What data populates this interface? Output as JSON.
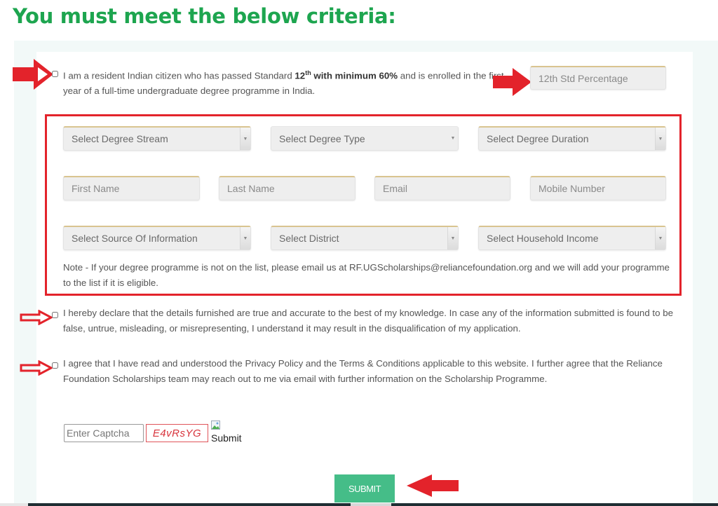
{
  "page": {
    "heading": "You must meet the below criteria:"
  },
  "eligibility": {
    "text_before": "I am a resident Indian citizen who has passed Standard ",
    "bold_12": "12",
    "sup_th": "th",
    "bold_min": " with minimum 60%",
    "text_after": " and is enrolled in the first year of a full-time undergraduate degree programme in India.",
    "checked": false,
    "percentage_placeholder": "12th Std Percentage"
  },
  "form": {
    "selects": {
      "degree_stream": "Select Degree Stream",
      "degree_type": "Select Degree Type",
      "degree_duration": "Select Degree Duration",
      "source_of_information": "Select Source Of Information",
      "district": "Select District",
      "household_income": "Select Household Income"
    },
    "inputs": {
      "first_name_placeholder": "First Name",
      "last_name_placeholder": "Last Name",
      "email_placeholder": "Email",
      "mobile_placeholder": "Mobile Number"
    },
    "note": "Note - If your degree programme is not on the list, please email us at RF.UGScholarships@reliancefoundation.org and we will add your programme to the list if it is eligible."
  },
  "declarations": [
    {
      "text": "I hereby declare that the details furnished are true and accurate to the best of my knowledge. In case any of the information submitted is found to be false, untrue, misleading, or misrepresenting, I understand it may result in the disqualification of my application.",
      "checked": false
    },
    {
      "text": "I agree that I have read and understood the Privacy Policy and the Terms & Conditions applicable to this website. I further agree that the Reliance Foundation Scholarships team may reach out to me via email with further information on the Scholarship Programme.",
      "checked": false
    }
  ],
  "captcha": {
    "placeholder": "Enter Captcha",
    "code": "E4vRsYG",
    "image_alt": "Submit"
  },
  "submit": {
    "label": "SUBMIT"
  },
  "colors": {
    "heading_green": "#1da54f",
    "submit_green": "#45bd88",
    "annotation_red": "#e3232b"
  }
}
